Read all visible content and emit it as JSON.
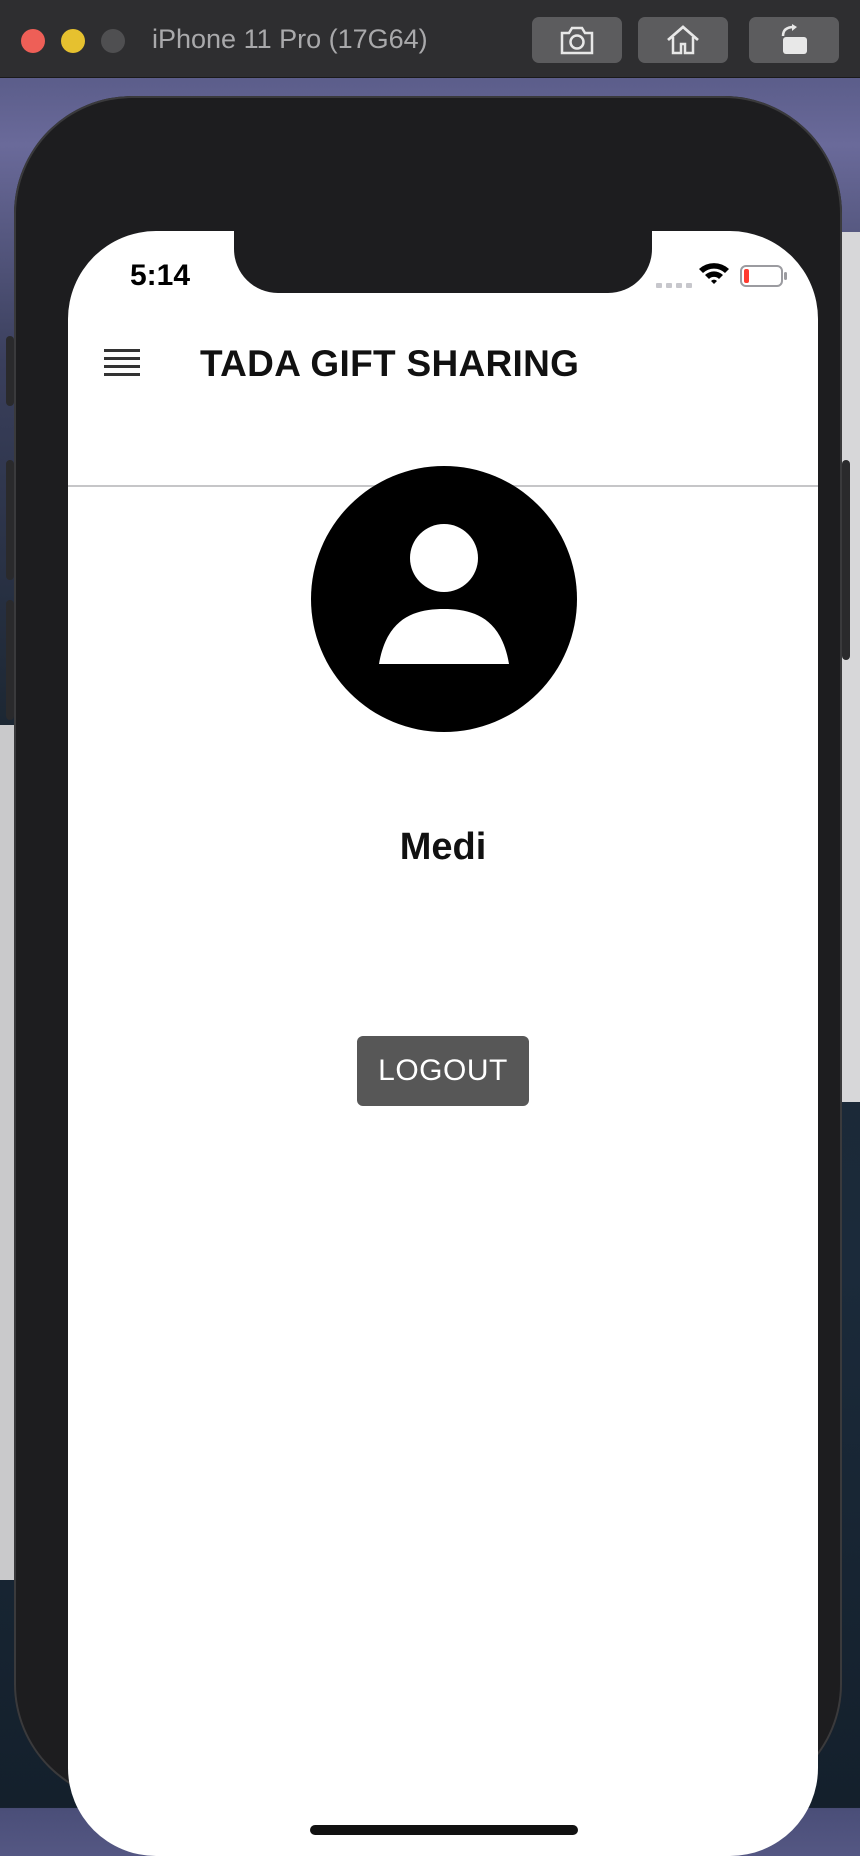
{
  "simulator": {
    "title": "iPhone 11 Pro (17G64)",
    "buttons": [
      "camera-icon",
      "home-icon",
      "rotate-icon"
    ]
  },
  "status_bar": {
    "time": "5:14",
    "battery_color": "#ff3b30"
  },
  "header": {
    "title": "TADA GIFT SHARING",
    "menu_icon": "hamburger-menu-icon"
  },
  "profile": {
    "avatar_icon": "user-avatar-icon",
    "name": "Medi"
  },
  "actions": {
    "logout_label": "LOGOUT",
    "logout_color": "#575757"
  }
}
